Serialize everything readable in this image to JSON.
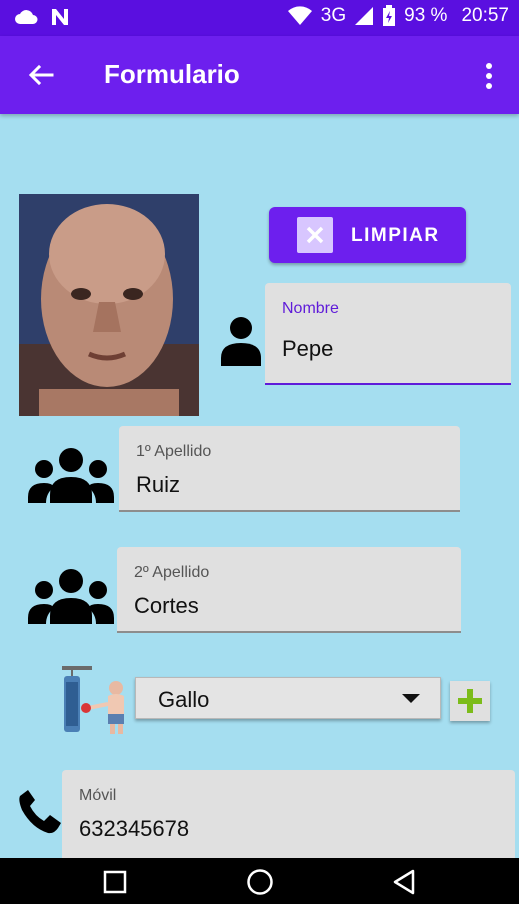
{
  "status_bar": {
    "network": "3G",
    "battery": "93 %",
    "time": "20:57"
  },
  "app_bar": {
    "title": "Formulario"
  },
  "actions": {
    "clear_label": "LIMPIAR"
  },
  "form": {
    "nombre": {
      "label": "Nombre",
      "value": "Pepe"
    },
    "apellido1": {
      "label": "1º Apellido",
      "value": "Ruiz"
    },
    "apellido2": {
      "label": "2º Apellido",
      "value": "Cortes"
    },
    "categoria": {
      "selected": "Gallo"
    },
    "movil": {
      "label": "Móvil",
      "value": "632345678"
    }
  },
  "icons": {
    "back": "arrow-left-icon",
    "more": "more-vert-icon",
    "person": "person-icon",
    "group": "group-icon",
    "boxer": "boxer-icon",
    "phone": "phone-icon",
    "add": "plus-icon"
  },
  "colors": {
    "primary": "#6d1fee",
    "status_bar": "#5a0fe0",
    "background": "#a5def0",
    "field_bg": "#e0e0e0",
    "accent_label": "#5f1bd9",
    "add_icon": "#7cbc1a"
  }
}
